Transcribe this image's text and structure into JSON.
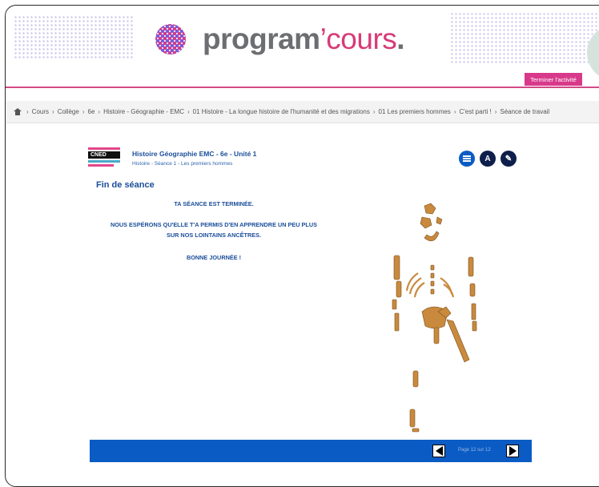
{
  "header": {
    "logo_text_main": "program",
    "logo_text_accent": "’cours",
    "logo_text_dot": ".",
    "end_button_label": "Terminer l'activité"
  },
  "breadcrumb": {
    "items": [
      "Cours",
      "Collège",
      "6e",
      "Histoire - Géographie - EMC",
      "01 Histoire - La longue histoire de l'humanité et des migrations",
      "01 Les premiers hommes",
      "C'est parti !",
      "Séance de travail"
    ],
    "separator": "›"
  },
  "lesson": {
    "cned_label": "CNED",
    "course_title": "Histoire Géographie EMC - 6e - Unité 1",
    "course_subtitle": "Histoire - Séance 1 - Les premiers hommes",
    "section_title": "Fin de séance",
    "messages": [
      "TA SÉANCE EST TERMINÉE.",
      "NOUS ESPÉRONS QU'ELLE T'A PERMIS D'EN APPRENDRE UN PEU PLUS",
      "SUR NOS LOINTAINS ANCÊTRES.",
      "BONNE JOURNÉE !"
    ],
    "nav_icons": [
      {
        "name": "menu-icon"
      },
      {
        "name": "glossary-icon",
        "glyph": "A"
      },
      {
        "name": "notebook-icon",
        "glyph": "✎"
      }
    ],
    "page_indicator": "Page 12 sur 12"
  },
  "colors": {
    "brand_pink": "#d8398a",
    "brand_grey": "#6d6e72",
    "cned_blue": "#0a5cc4",
    "text_blue": "#1b4e9a",
    "bone": "#c98a3e"
  },
  "icons": [
    "home-icon",
    "menu-icon",
    "glossary-icon",
    "notebook-icon",
    "prev-arrow-icon",
    "next-arrow-icon",
    "skeleton-image"
  ]
}
